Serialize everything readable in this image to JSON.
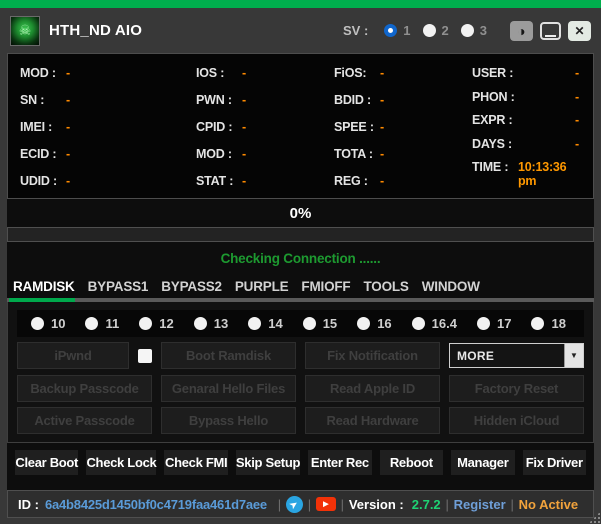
{
  "colors": {
    "accent_green": "#00ae4d",
    "value_orange": "#ff8a00",
    "status_green": "#1d9a30",
    "version_green": "#1ed374",
    "link_blue": "#5a9bd8",
    "warning_orange": "#f2a33c"
  },
  "titlebar": {
    "title": "HTH_ND AIO",
    "sv_label": "SV :",
    "sv_options": [
      {
        "label": "1",
        "selected": true
      },
      {
        "label": "2",
        "selected": false
      },
      {
        "label": "3",
        "selected": false
      }
    ]
  },
  "icons": {
    "app_logo": "☠",
    "contrast": "◑",
    "close": "✕",
    "telegram": "➤",
    "youtube": "▶",
    "caret": "▼"
  },
  "info": {
    "columns": [
      {
        "fields": [
          {
            "label": "MOD :",
            "value": "-"
          },
          {
            "label": "SN :",
            "value": "-"
          },
          {
            "label": "IMEI :",
            "value": "-"
          },
          {
            "label": "ECID :",
            "value": "-"
          },
          {
            "label": "UDID :",
            "value": "-"
          }
        ]
      },
      {
        "fields": [
          {
            "label": "IOS :",
            "value": "-"
          },
          {
            "label": "PWN :",
            "value": "-"
          },
          {
            "label": "CPID :",
            "value": "-"
          },
          {
            "label": "MOD :",
            "value": "-"
          },
          {
            "label": "STAT :",
            "value": "-"
          }
        ]
      },
      {
        "fields": [
          {
            "label": "FiOS:",
            "value": "-"
          },
          {
            "label": "BDID :",
            "value": "-"
          },
          {
            "label": "SPEE :",
            "value": "-"
          },
          {
            "label": "TOTA :",
            "value": "-"
          },
          {
            "label": "REG :",
            "value": "-"
          }
        ]
      },
      {
        "fields": [
          {
            "label": "USER :",
            "value": "-"
          },
          {
            "label": "PHON :",
            "value": "-"
          },
          {
            "label": "EXPR :",
            "value": "-"
          },
          {
            "label": "DAYS :",
            "value": "-"
          },
          {
            "label": "TIME :",
            "value": "10:13:36 pm"
          }
        ]
      }
    ]
  },
  "progress": {
    "percent": "0%",
    "value": 0
  },
  "status_message": "Checking Connection ......",
  "tabs": {
    "items": [
      "RAMDISK",
      "BYPASS1",
      "BYPASS2",
      "PURPLE",
      "FMIOFF",
      "TOOLS",
      "WINDOW"
    ],
    "active": "RAMDISK"
  },
  "ramdisk": {
    "versions": [
      "10",
      "11",
      "12",
      "13",
      "14",
      "15",
      "16",
      "16.4",
      "17",
      "18"
    ],
    "buttons": {
      "ipwnd": "iPwnd",
      "boot_ramdisk": "Boot Ramdisk",
      "fix_notification": "Fix Notification",
      "more": "MORE",
      "backup_passcode": "Backup Passcode",
      "genaral_hello_files": "Genaral Hello Files",
      "read_apple_id": "Read Apple ID",
      "factory_reset": "Factory Reset",
      "active_passcode": "Active Passcode",
      "bypass_hello": "Bypass Hello",
      "read_hardware": "Read Hardware",
      "hidden_icloud": "Hidden iCloud"
    }
  },
  "actions": [
    "Clear Boot",
    "Check Lock",
    "Check FMI",
    "Skip Setup",
    "Enter Rec",
    "Reboot",
    "Manager",
    "Fix Driver"
  ],
  "statusbar": {
    "id_label": "ID :",
    "id_value": "6a4b8425d1450bf0c4719faa461d7aee",
    "separator": "|",
    "version_label": "Version :",
    "version_value": "2.7.2",
    "register_label": "Register",
    "active_status": "No Active"
  }
}
